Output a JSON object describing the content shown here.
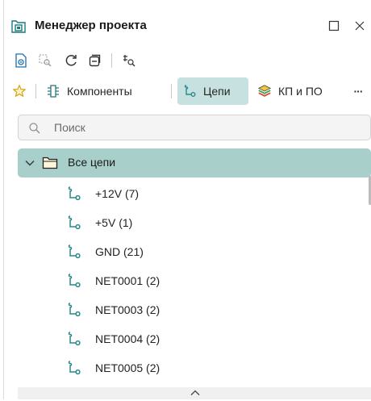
{
  "panel": {
    "title": "Менеджер проекта",
    "title_icon": "project-manager-icon",
    "window_controls": {
      "restore_icon": "restore-icon",
      "close_icon": "close-icon"
    }
  },
  "toolbar": {
    "buttons": [
      "document-view-icon",
      "zoom-selection-icon",
      "refresh-icon",
      "collapse-all-icon",
      "find-component-icon"
    ]
  },
  "tabs": [
    {
      "label": "",
      "icon": "star-icon"
    },
    {
      "label": "Компоненты",
      "icon": "component-icon"
    },
    {
      "label": "Цепи",
      "icon": "net-icon",
      "active": true
    },
    {
      "label": "КП и ПО",
      "icon": "layers-icon"
    }
  ],
  "more_label": "···",
  "search": {
    "placeholder": "Поиск",
    "value": ""
  },
  "tree": {
    "root_label": "Все цепи",
    "items": [
      "+12V (7)",
      "+5V (1)",
      "GND (21)",
      "NET0001 (2)",
      "NET0003 (2)",
      "NET0004 (2)",
      "NET0005 (2)"
    ]
  },
  "colors": {
    "active_tab": "#c6e1df",
    "selected_row": "#a9cfcb",
    "accent": "#2a8a8a"
  }
}
